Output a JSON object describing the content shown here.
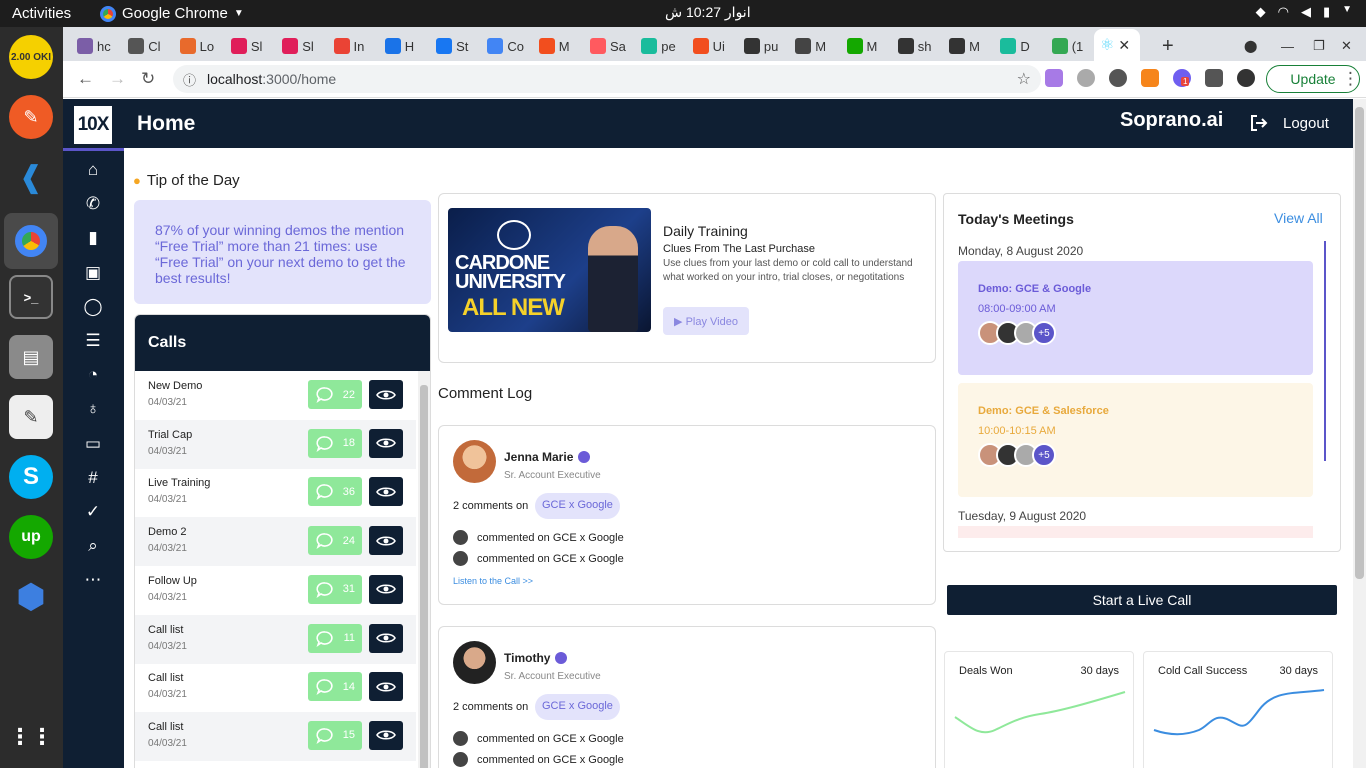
{
  "os": {
    "activities": "Activities",
    "app_name": "Google Chrome",
    "clock": "انوار 10:27 ش"
  },
  "dock": {
    "items": [
      {
        "name": "OKI",
        "label": "2.00 OKI",
        "color": "#f5d000"
      },
      {
        "name": "Postman",
        "color": "#ef5b25"
      },
      {
        "name": "VS Code",
        "color": "#2c2c2c"
      },
      {
        "name": "Chrome",
        "color": "#4d4d4d"
      },
      {
        "name": "Terminal",
        "color": "#333333"
      },
      {
        "name": "Files",
        "color": "#7b7b7b"
      },
      {
        "name": "Text Editor",
        "color": "#eeeeee"
      },
      {
        "name": "Skype",
        "color": "#00aff0"
      },
      {
        "name": "Upwork",
        "color": "#14a800"
      },
      {
        "name": "Network",
        "color": "#3d7fe0"
      }
    ]
  },
  "browser": {
    "tabs": [
      "hc",
      "Cl",
      "Lo",
      "Sl",
      "Sl",
      "In",
      "H",
      "St",
      "Co",
      "M",
      "Sa",
      "pe",
      "Ui",
      "pu",
      "M",
      "M",
      "sh",
      "M",
      "D",
      "(1"
    ],
    "active_tab_index": 20,
    "url_host": "localhost",
    "url_path": ":3000/home",
    "update_label": "Update",
    "ext_badge": "1"
  },
  "app": {
    "logo": "10X",
    "page_title": "Home",
    "brand": "Soprano.ai",
    "logout_label": "Logout",
    "sidebar_icons": [
      "home-icon",
      "phone-icon",
      "bar-chart-icon",
      "chip-icon",
      "chat-icon",
      "list-icon",
      "pie-chart-icon",
      "award-icon",
      "tv-icon",
      "hash-icon",
      "user-check-icon",
      "search-icon",
      "more-icon"
    ]
  },
  "tip": {
    "heading": "Tip of the Day",
    "text": "87% of your winning demos the mention “Free Trial” more than 21 times: use “Free Trial” on your next demo to get the best results!"
  },
  "calls": {
    "heading": "Calls",
    "rows": [
      {
        "name": "New Demo",
        "date": "04/03/21",
        "count": "22"
      },
      {
        "name": "Trial Cap",
        "date": "04/03/21",
        "count": "18"
      },
      {
        "name": "Live Training",
        "date": "04/03/21",
        "count": "36"
      },
      {
        "name": "Demo 2",
        "date": "04/03/21",
        "count": "24"
      },
      {
        "name": "Follow Up",
        "date": "04/03/21",
        "count": "31"
      },
      {
        "name": "Call list",
        "date": "04/03/21",
        "count": "11"
      },
      {
        "name": "Call list",
        "date": "04/03/21",
        "count": "14"
      },
      {
        "name": "Call list",
        "date": "04/03/21",
        "count": "15"
      }
    ]
  },
  "training": {
    "thumb_line1": "CARDONE",
    "thumb_line2": "UNIVERSITY",
    "thumb_line3": "ALL NEW",
    "title": "Daily Training",
    "subtitle": "Clues From The Last Purchase",
    "description": "Use clues from your last demo or cold call to understand what worked on your intro, trial closes, or negotitations",
    "play_label": "▶ Play Video"
  },
  "comments": {
    "heading": "Comment Log",
    "entries": [
      {
        "name": "Jenna Marie",
        "role": "Sr. Account Executive",
        "count_text": "2 comments on",
        "chip": "GCE x Google",
        "activity": [
          "commented on GCE x Google",
          "commented on GCE x Google"
        ],
        "listen": "Listen to the Call >>"
      },
      {
        "name": "Timothy",
        "role": "Sr. Account Executive",
        "count_text": "2 comments on",
        "chip": "GCE x Google",
        "activity": [
          "commented on GCE x Google",
          "commented on GCE x Google"
        ]
      }
    ]
  },
  "meetings": {
    "heading": "Today's Meetings",
    "view_all": "View All",
    "day1": "Monday, 8 August 2020",
    "day2": "Tuesday, 9 August 2020",
    "items": [
      {
        "title": "Demo: GCE & Google",
        "time": "08:00-09:00 AM",
        "extra": "+5",
        "bg": "#dcd8fb",
        "fg": "#6b5bd8"
      },
      {
        "title": "Demo: GCE & Salesforce",
        "time": "10:00-10:15 AM",
        "extra": "+5",
        "bg": "#fdf6e7",
        "fg": "#e8a93c"
      }
    ]
  },
  "live_call_label": "Start a Live Call",
  "stats": [
    {
      "label": "Deals Won",
      "period": "30 days",
      "color": "#8fe89a"
    },
    {
      "label": "Cold Call Success",
      "period": "30 days",
      "color": "#3b8de0"
    }
  ]
}
